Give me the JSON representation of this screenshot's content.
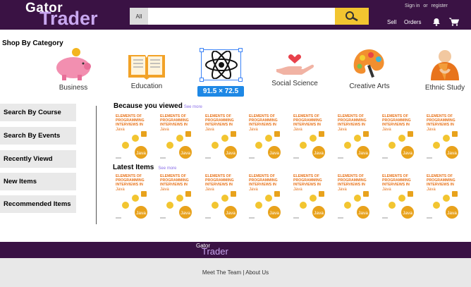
{
  "header": {
    "logo_top": "Gator",
    "logo_bottom": "Trader",
    "category_label": "All",
    "search_placeholder": "",
    "sign_in": "Sign in",
    "or": "or",
    "register": "register",
    "sell": "Sell",
    "orders": "Orders"
  },
  "section_title": "Shop By Category",
  "categories": [
    {
      "label": "Business",
      "icon": "piggy-bank-icon"
    },
    {
      "label": "Education",
      "icon": "book-icon"
    },
    {
      "label": "",
      "icon": "atom-icon"
    },
    {
      "label": "Social Science",
      "icon": "heart-hand-icon"
    },
    {
      "label": "Creative Arts",
      "icon": "palette-icon"
    },
    {
      "label": "Ethnic Study",
      "icon": "monk-icon"
    }
  ],
  "selection_size": "91.5 × 72.5",
  "sidebar": [
    "Search By Course",
    "Search By Events",
    "Recently Viewd",
    "New Items",
    "Recommended Items"
  ],
  "because": {
    "title": "Because you viewed",
    "see_more": "See more"
  },
  "latest": {
    "title": "Latest Items",
    "see_more": "See more"
  },
  "book": {
    "line1": "ELEMENTS OF",
    "line2": "PROGRAMMING",
    "line3": "INTERVIEWS",
    "line4": "IN",
    "line5": "Java",
    "badge": "Java"
  },
  "footer": {
    "logo_top": "Gator",
    "logo_bottom": "Trader",
    "links": "Meet The Team | About Us"
  },
  "colors": {
    "header": "#3a1244",
    "logo_accent": "#c9a8f0",
    "search_button": "#f2c530",
    "book_title": "#e8741c",
    "book_badge": "#e8a21c",
    "selection": "#1e88e5",
    "see_more": "#8a6ee8"
  }
}
